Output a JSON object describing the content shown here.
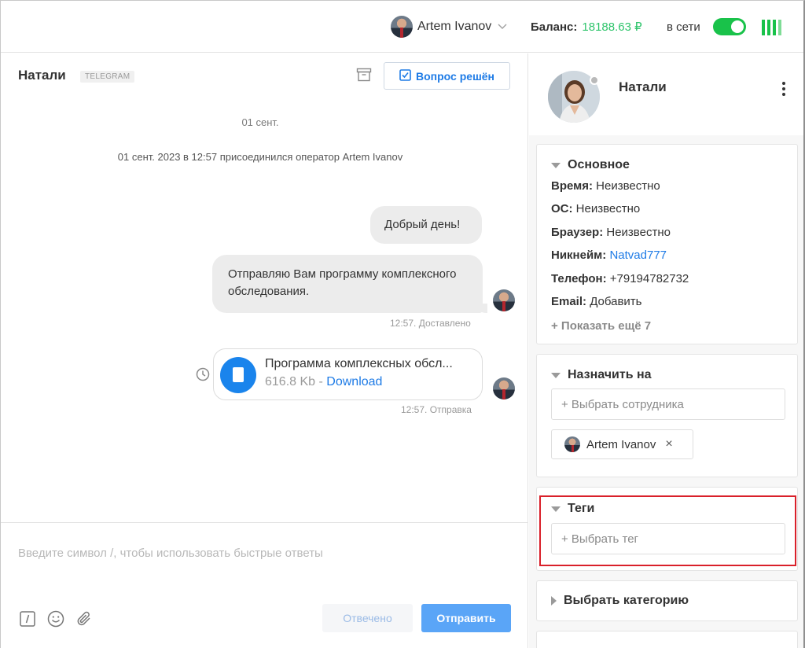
{
  "topbar": {
    "user_name": "Artem Ivanov",
    "balance_label": "Баланс:",
    "balance_value": "18188.63 ₽",
    "online_label": "в сети",
    "online_color": "#19c24a"
  },
  "chat": {
    "title": "Натали",
    "source": "TELEGRAM",
    "resolve_button": "Вопрос решён",
    "date_separator": "01 сент.",
    "system_message": "01 сент. 2023 в 12:57 присоединился оператор Artem Ivanov",
    "messages": [
      {
        "text": "Добрый день!"
      },
      {
        "text": "Отправляю Вам программу комплексного обследования.",
        "meta": "12:57. Доставлено"
      }
    ],
    "file": {
      "name": "Программа комплексных обсл...",
      "size": "616.8 Kb",
      "separator": " - ",
      "download": "Download",
      "meta": "12:57. Отправка"
    },
    "composer": {
      "placeholder": "Введите символ /, чтобы использовать быстрые ответы",
      "answered_button": "Отвечено",
      "send_button": "Отправить"
    }
  },
  "contact": {
    "name": "Натали",
    "basic": {
      "title": "Основное",
      "time_label": "Время:",
      "time_value": "Неизвестно",
      "os_label": "ОС:",
      "os_value": "Неизвестно",
      "browser_label": "Браузер:",
      "browser_value": "Неизвестно",
      "nick_label": "Никнейм:",
      "nick_value": "Natvad777",
      "phone_label": "Телефон:",
      "phone_value": "+79194782732",
      "email_label": "Email:",
      "email_value": "Добавить",
      "show_more": "+ Показать ещё 7"
    },
    "assign": {
      "title": "Назначить на",
      "placeholder": "+ Выбрать сотрудника",
      "assignee": "Artem Ivanov",
      "remove": "×"
    },
    "tags": {
      "title": "Теги",
      "placeholder": "+ Выбрать тег"
    },
    "category": {
      "title": "Выбрать категорию"
    }
  },
  "colors": {
    "accent": "#1e7be6",
    "online": "#19c24a",
    "highlight": "#d9202a"
  }
}
